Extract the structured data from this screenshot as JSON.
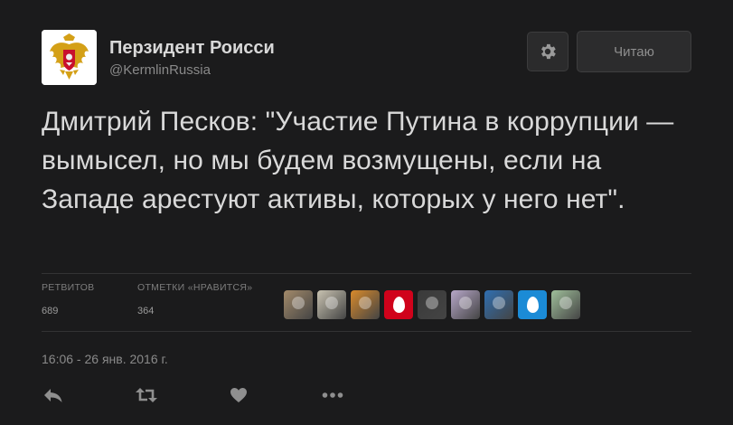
{
  "user": {
    "display_name": "Перзидент Роисси",
    "handle": "@KermlinRussia",
    "avatar_icon": "russian-eagle-coat-of-arms"
  },
  "header": {
    "settings_icon": "gear-icon",
    "follow_label": "Читаю"
  },
  "tweet": {
    "text": "Дмитрий Песков: \"Участие Путина в коррупции — вымысел, но мы будем возмущены, если на Западе арестуют активы, которых у него нет\"."
  },
  "stats": {
    "retweets_label": "РЕТВИТОВ",
    "retweets_count": "689",
    "likes_label": "ОТМЕТКИ «НРАВИТСЯ»",
    "likes_count": "364"
  },
  "likers": [
    {
      "kind": "photo",
      "color": "#a38a6a"
    },
    {
      "kind": "photo",
      "color": "#c9c3b1"
    },
    {
      "kind": "photo",
      "color": "#d98a2b"
    },
    {
      "kind": "egg",
      "color": "#d0021b"
    },
    {
      "kind": "photo",
      "color": "#3a3a3a"
    },
    {
      "kind": "photo",
      "color": "#b7a7c9"
    },
    {
      "kind": "photo",
      "color": "#2f6fb2"
    },
    {
      "kind": "egg",
      "color": "#1b8bd6"
    },
    {
      "kind": "photo",
      "color": "#9fbf9a"
    }
  ],
  "timestamp": "16:06 - 26 янв. 2016 г.",
  "actions": {
    "reply_icon": "reply-icon",
    "retweet_icon": "retweet-icon",
    "like_icon": "heart-icon",
    "more_icon": "more-icon"
  },
  "colors": {
    "background": "#1b1b1c",
    "text": "#d9d9d9",
    "muted": "#8a8a8a"
  }
}
